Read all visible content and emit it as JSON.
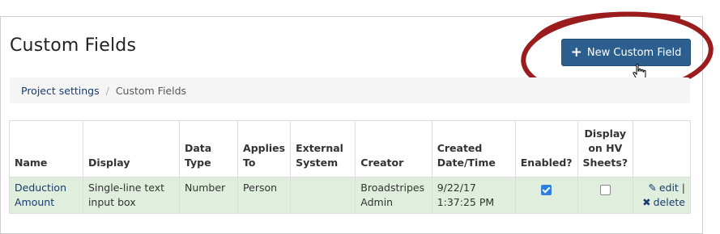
{
  "page": {
    "title": "Custom Fields",
    "new_button_label": "New Custom Field"
  },
  "breadcrumb": {
    "parent": "Project settings",
    "separator": "/",
    "current": "Custom Fields"
  },
  "table": {
    "headers": {
      "name": "Name",
      "display": "Display",
      "data_type": "Data Type",
      "applies_to": "Applies To",
      "external_system": "External System",
      "creator": "Creator",
      "created": "Created Date/Time",
      "enabled": "Enabled?",
      "display_hv": "Display on HV Sheets?"
    },
    "rows": [
      {
        "name": "Deduction Amount",
        "display": "Single-line text input box",
        "data_type": "Number",
        "applies_to": "Person",
        "external_system": "",
        "creator": "Broadstripes Admin",
        "created": "9/22/17 1:37:25 PM",
        "enabled": true,
        "display_hv": false,
        "edit_label": "edit",
        "delete_label": "delete"
      }
    ]
  },
  "colors": {
    "button_bg": "#2c5f8e",
    "row_highlight": "#dfeedd",
    "link": "#1a3b6e",
    "annotation_circle": "#9b1c1c"
  }
}
